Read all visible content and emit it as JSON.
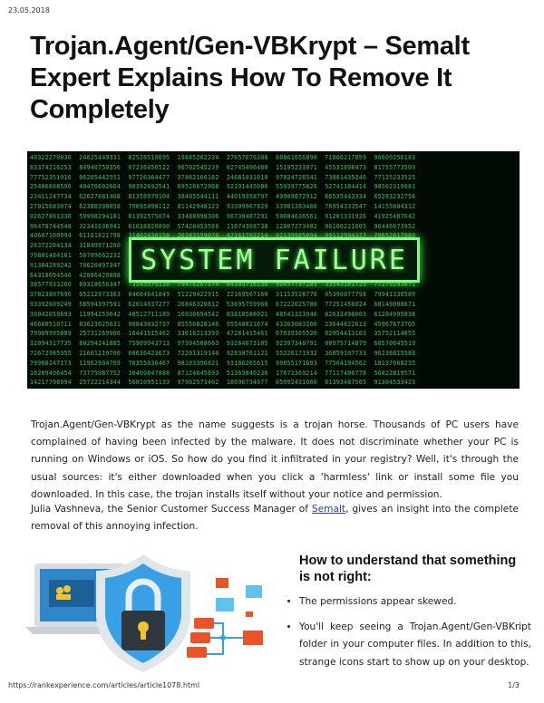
{
  "date": "23.05.2018",
  "title": "Trojan.Agent/Gen-VBKrypt – Semalt Expert Explains How To Remove It Completely",
  "hero_image": {
    "text": "SYSTEM FAILURE"
  },
  "paragraphs": {
    "p1": "Trojan.Agent/Gen-VBKrypt as the name suggests is a trojan horse. Thousands of PC users have complained of having been infected by the malware. It does not discriminate whether your PC is running on Windows or iOS. So how do you find it infiltrated in your registry? Well, it's through the usual sources: it's either downloaded when you click a 'harmless' link or install some file you downloaded. In this case, the trojan installs itself without your notice and permission.",
    "p2_before": "Julia Vashneva, the Senior Customer Success Manager of ",
    "p2_link": "Semalt",
    "p2_after": ", gives an insight into the complete removal of this annoying infection."
  },
  "section": {
    "heading": "How to understand that something is not right:",
    "bullets": [
      "The permissions appear skewed.",
      "You'll keep seeing a Trojan.Agent/Gen-VBKript folder in your computer files. In addition to this, strange icons start to show up on your desktop."
    ]
  },
  "footer": {
    "url": "https://rankexperience.com/articles/article1078.html",
    "page": "1/3"
  },
  "colors": {
    "shield": "#3aa0e6",
    "envelope_orange": "#e8532a",
    "envelope_blue": "#5fc3ef",
    "matrix_green": "#3fbf5a",
    "link": "#2a3fb0"
  }
}
